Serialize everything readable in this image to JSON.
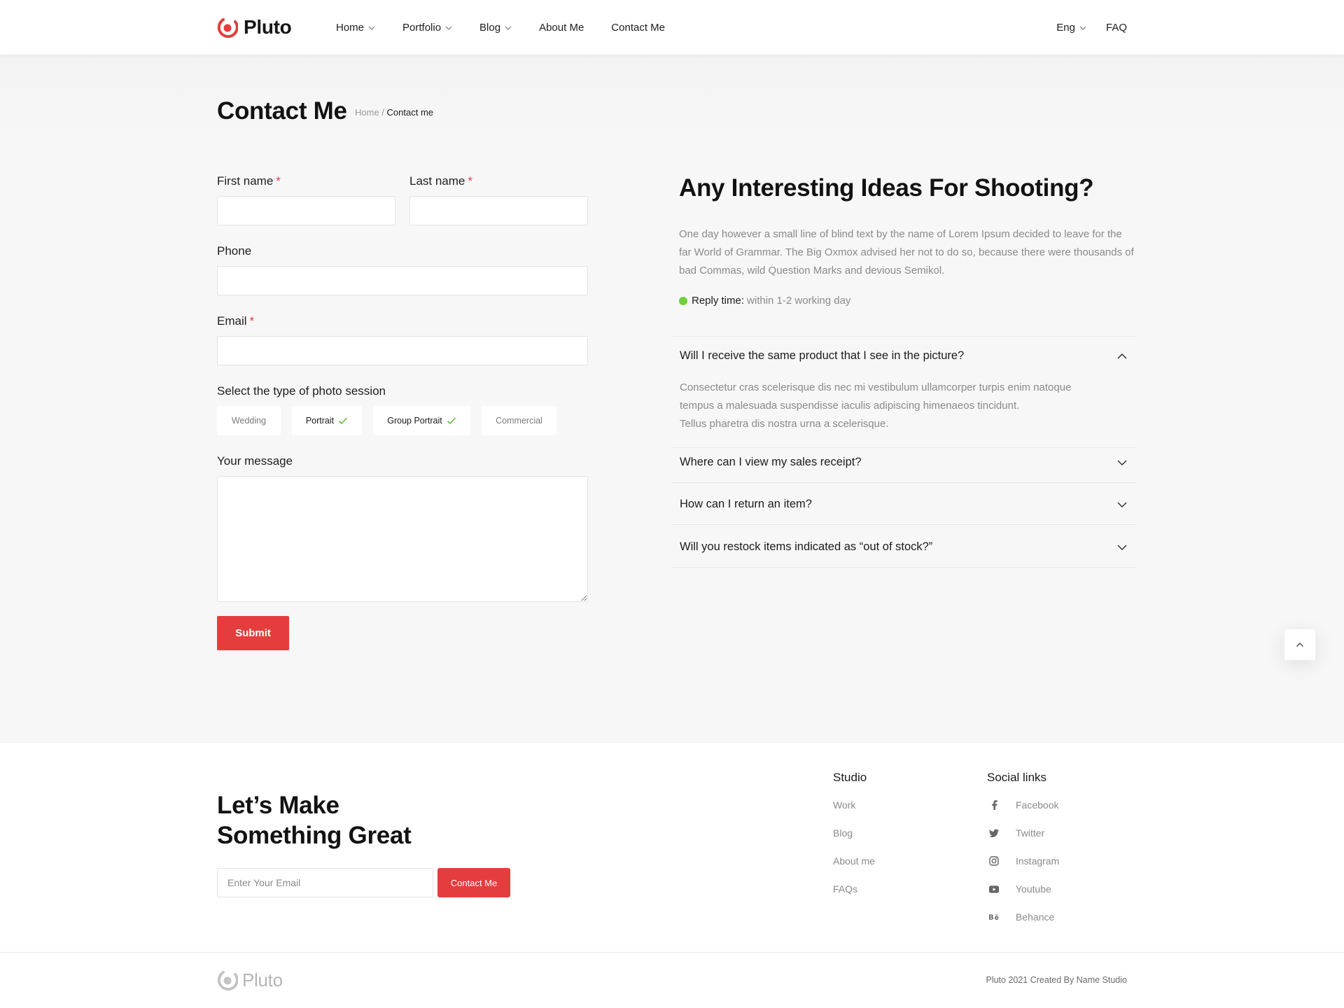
{
  "header": {
    "logo_text": "Pluto",
    "nav": [
      {
        "label": "Home",
        "has_dropdown": true
      },
      {
        "label": "Portfolio",
        "has_dropdown": true
      },
      {
        "label": "Blog",
        "has_dropdown": true
      },
      {
        "label": "About Me",
        "has_dropdown": false
      },
      {
        "label": "Contact Me",
        "has_dropdown": false
      }
    ],
    "language": "Eng",
    "faq": "FAQ"
  },
  "page": {
    "title": "Contact Me",
    "breadcrumb": {
      "home": "Home",
      "separator": " / ",
      "current": "Contact me"
    }
  },
  "form": {
    "first_name": {
      "label": "First name",
      "required_mark": "*",
      "value": ""
    },
    "last_name": {
      "label": "Last name",
      "required_mark": "*",
      "value": ""
    },
    "phone": {
      "label": "Phone",
      "value": ""
    },
    "email": {
      "label": "Email",
      "required_mark": "*",
      "value": ""
    },
    "session_label": "Select the type of photo session",
    "sessions": [
      {
        "label": "Wedding",
        "selected": false
      },
      {
        "label": "Portrait",
        "selected": true
      },
      {
        "label": "Group Portrait",
        "selected": true
      },
      {
        "label": "Commercial",
        "selected": false
      }
    ],
    "message": {
      "label": "Your message",
      "value": ""
    },
    "submit_label": "Submit"
  },
  "info": {
    "title": "Any Interesting Ideas For Shooting?",
    "description": "One day however a small line of blind text by the name of Lorem Ipsum decided to leave for the far World of Grammar. The Big Oxmox advised her not to do so, because there were thousands of bad Commas, wild Question Marks and devious Semikol.",
    "reply_label": "Reply time:",
    "reply_value": "within 1-2 working day",
    "reply_status_color": "#6fce3c"
  },
  "faq": [
    {
      "question": "Will I receive the same product that I see in the picture?",
      "expanded": true,
      "answer_lines": [
        "Consectetur cras scelerisque dis nec mi vestibulum ullamcorper turpis enim natoque",
        "tempus a malesuada suspendisse iaculis adipiscing himenaeos tincidunt.",
        "Tellus pharetra dis nostra urna a scelerisque."
      ]
    },
    {
      "question": "Where can I view my sales receipt?",
      "expanded": false
    },
    {
      "question": "How can I return an item?",
      "expanded": false
    },
    {
      "question": "Will you restock items indicated as “out of stock?”",
      "expanded": false
    }
  ],
  "footer": {
    "cta_title_line1": "Let’s Make",
    "cta_title_line2": "Something Great",
    "email_placeholder": "Enter Your Email",
    "cta_button": "Contact Me",
    "studio": {
      "title": "Studio",
      "links": [
        "Work",
        "Blog",
        "About me",
        "FAQs"
      ]
    },
    "social": {
      "title": "Social links",
      "links": [
        {
          "label": "Facebook",
          "icon": "facebook-icon"
        },
        {
          "label": "Twitter",
          "icon": "twitter-icon"
        },
        {
          "label": "Instagram",
          "icon": "instagram-icon"
        },
        {
          "label": "Youtube",
          "icon": "youtube-icon"
        },
        {
          "label": "Behance",
          "icon": "behance-icon"
        }
      ]
    },
    "logo_text": "Pluto",
    "copyright": "Pluto 2021 Created By Name Studio"
  },
  "colors": {
    "accent": "#e53d3d",
    "text": "#151515",
    "muted": "#8a8a8a",
    "background": "#f7f7f7"
  }
}
